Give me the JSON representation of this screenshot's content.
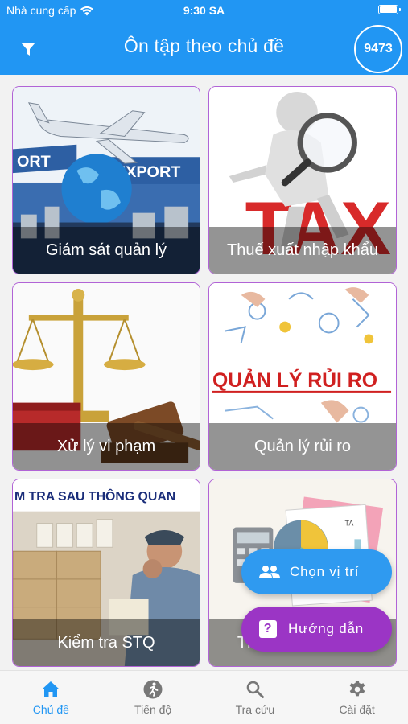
{
  "status_bar": {
    "carrier": "Nhà cung cấp",
    "time": "9:30 SA"
  },
  "header": {
    "title": "Ôn tập theo chủ đề",
    "count": "9473"
  },
  "topics": [
    {
      "label": "Giám sát quản lý",
      "image_text_1": "ORT",
      "image_text_2": "EXPORT"
    },
    {
      "label": "Thuế xuất nhập khẩu",
      "image_text": "TAX"
    },
    {
      "label": "Xử lý vi phạm"
    },
    {
      "label": "Quản lý rủi ro",
      "image_text": "QUẢN LÝ RỦI RO"
    },
    {
      "label": "Kiểm tra STQ",
      "image_text": "M TRA SAU THÔNG QUAN"
    },
    {
      "label": "Thanh tra kiểm tra",
      "image_text": "TA"
    }
  ],
  "floating": {
    "choose_position": "Chọn vị trí",
    "guide": "Hướng dẫn",
    "guide_icon": "?"
  },
  "nav": [
    {
      "label": "Chủ đề",
      "icon": "home-icon",
      "active": true
    },
    {
      "label": "Tiến độ",
      "icon": "running-person-icon",
      "active": false
    },
    {
      "label": "Tra cứu",
      "icon": "search-icon",
      "active": false
    },
    {
      "label": "Cài đặt",
      "icon": "gear-icon",
      "active": false
    }
  ],
  "colors": {
    "primary": "#2196f3",
    "accent_purple": "#9b35c5",
    "card_border": "#b163d6"
  }
}
